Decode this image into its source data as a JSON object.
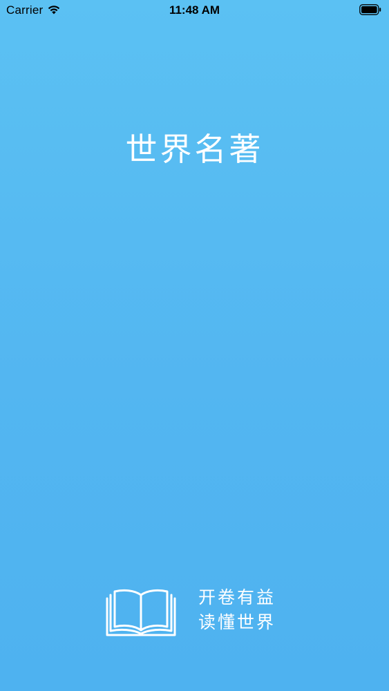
{
  "status_bar": {
    "carrier": "Carrier",
    "time": "11:48 AM",
    "wifi_icon": "wifi-icon",
    "battery_icon": "battery-icon"
  },
  "splash": {
    "title": "世界名著",
    "slogan_line1": "开卷有益",
    "slogan_line2": "读懂世界",
    "book_icon": "open-book-icon"
  },
  "colors": {
    "background_top": "#5bc1f3",
    "background_bottom": "#4eb2f0",
    "foreground": "#ffffff"
  }
}
